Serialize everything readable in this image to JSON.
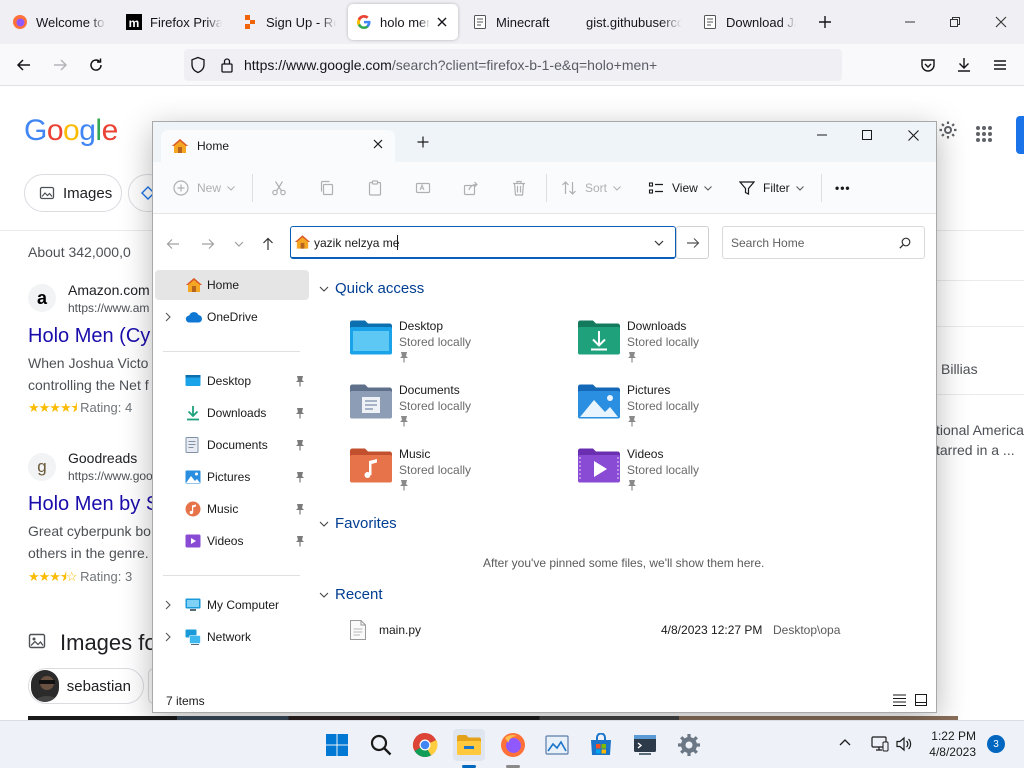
{
  "browser": {
    "tabs": [
      {
        "title": "Welcome to F",
        "icon": "firefox-icon"
      },
      {
        "title": "Firefox Privac",
        "icon": "mozilla-m-icon"
      },
      {
        "title": "Sign Up - Rep",
        "icon": "replit-icon"
      },
      {
        "title": "holo men",
        "icon": "google-g-icon",
        "active": true
      },
      {
        "title": "Minecraft",
        "icon": "page-icon"
      },
      {
        "title": "gist.githubuserco",
        "icon": ""
      },
      {
        "title": "Download Jav",
        "icon": "page-icon"
      }
    ],
    "url_host": "https://www.google.com",
    "url_path": "/search?client=firefox-b-1-e&q=holo+men+"
  },
  "google": {
    "logo": "Google",
    "chip_images": "Images",
    "result_count": "About 342,000,0",
    "results": [
      {
        "favicon": "a",
        "site": "Amazon.com",
        "url": "https://www.am",
        "title": "Holo Men (Cy",
        "desc1": "When Joshua Victo",
        "desc2": "controlling the Net f",
        "rating": "Rating: 4",
        "stars": "★★★★⯨"
      },
      {
        "favicon": "g",
        "site": "Goodreads",
        "url": "https://www.goo",
        "title": "Holo Men by S",
        "desc1": "Great cyberpunk bo",
        "desc2": "others in the genre.",
        "rating": "Rating: 3",
        "stars": "★★★⯨☆"
      }
    ],
    "images_heading": "Images fo",
    "chip_sebastian": "sebastian",
    "side_billias": "Billias",
    "side_text1": "tional American",
    "side_text2": "tarred in a ..."
  },
  "explorer": {
    "tab_title": "Home",
    "toolbar": {
      "new": "New",
      "sort": "Sort",
      "view": "View",
      "filter": "Filter",
      "more": "•••"
    },
    "address_value": "yazik nelzya me",
    "search_placeholder": "Search Home",
    "sidebar": {
      "home": "Home",
      "onedrive": "OneDrive",
      "pinned": [
        "Desktop",
        "Downloads",
        "Documents",
        "Pictures",
        "Music",
        "Videos"
      ],
      "my_computer": "My Computer",
      "network": "Network"
    },
    "quick_access_heading": "Quick access",
    "quick_access": [
      {
        "name": "Desktop",
        "sub": "Stored locally",
        "color": "#1aa3e8"
      },
      {
        "name": "Downloads",
        "sub": "Stored locally",
        "color": "#1fa27c"
      },
      {
        "name": "Documents",
        "sub": "Stored locally",
        "color": "#7e8fa6"
      },
      {
        "name": "Pictures",
        "sub": "Stored locally",
        "color": "#2a8fe0"
      },
      {
        "name": "Music",
        "sub": "Stored locally",
        "color": "#e6734a"
      },
      {
        "name": "Videos",
        "sub": "Stored locally",
        "color": "#8a4bd4"
      }
    ],
    "favorites_heading": "Favorites",
    "favorites_empty": "After you've pinned some files, we'll show them here.",
    "recent_heading": "Recent",
    "recent": [
      {
        "name": "main.py",
        "date": "4/8/2023 12:27 PM",
        "location": "Desktop\\opa"
      }
    ],
    "status": "7 items"
  },
  "taskbar": {
    "time": "1:22 PM",
    "date": "4/8/2023",
    "notifications": "3"
  }
}
